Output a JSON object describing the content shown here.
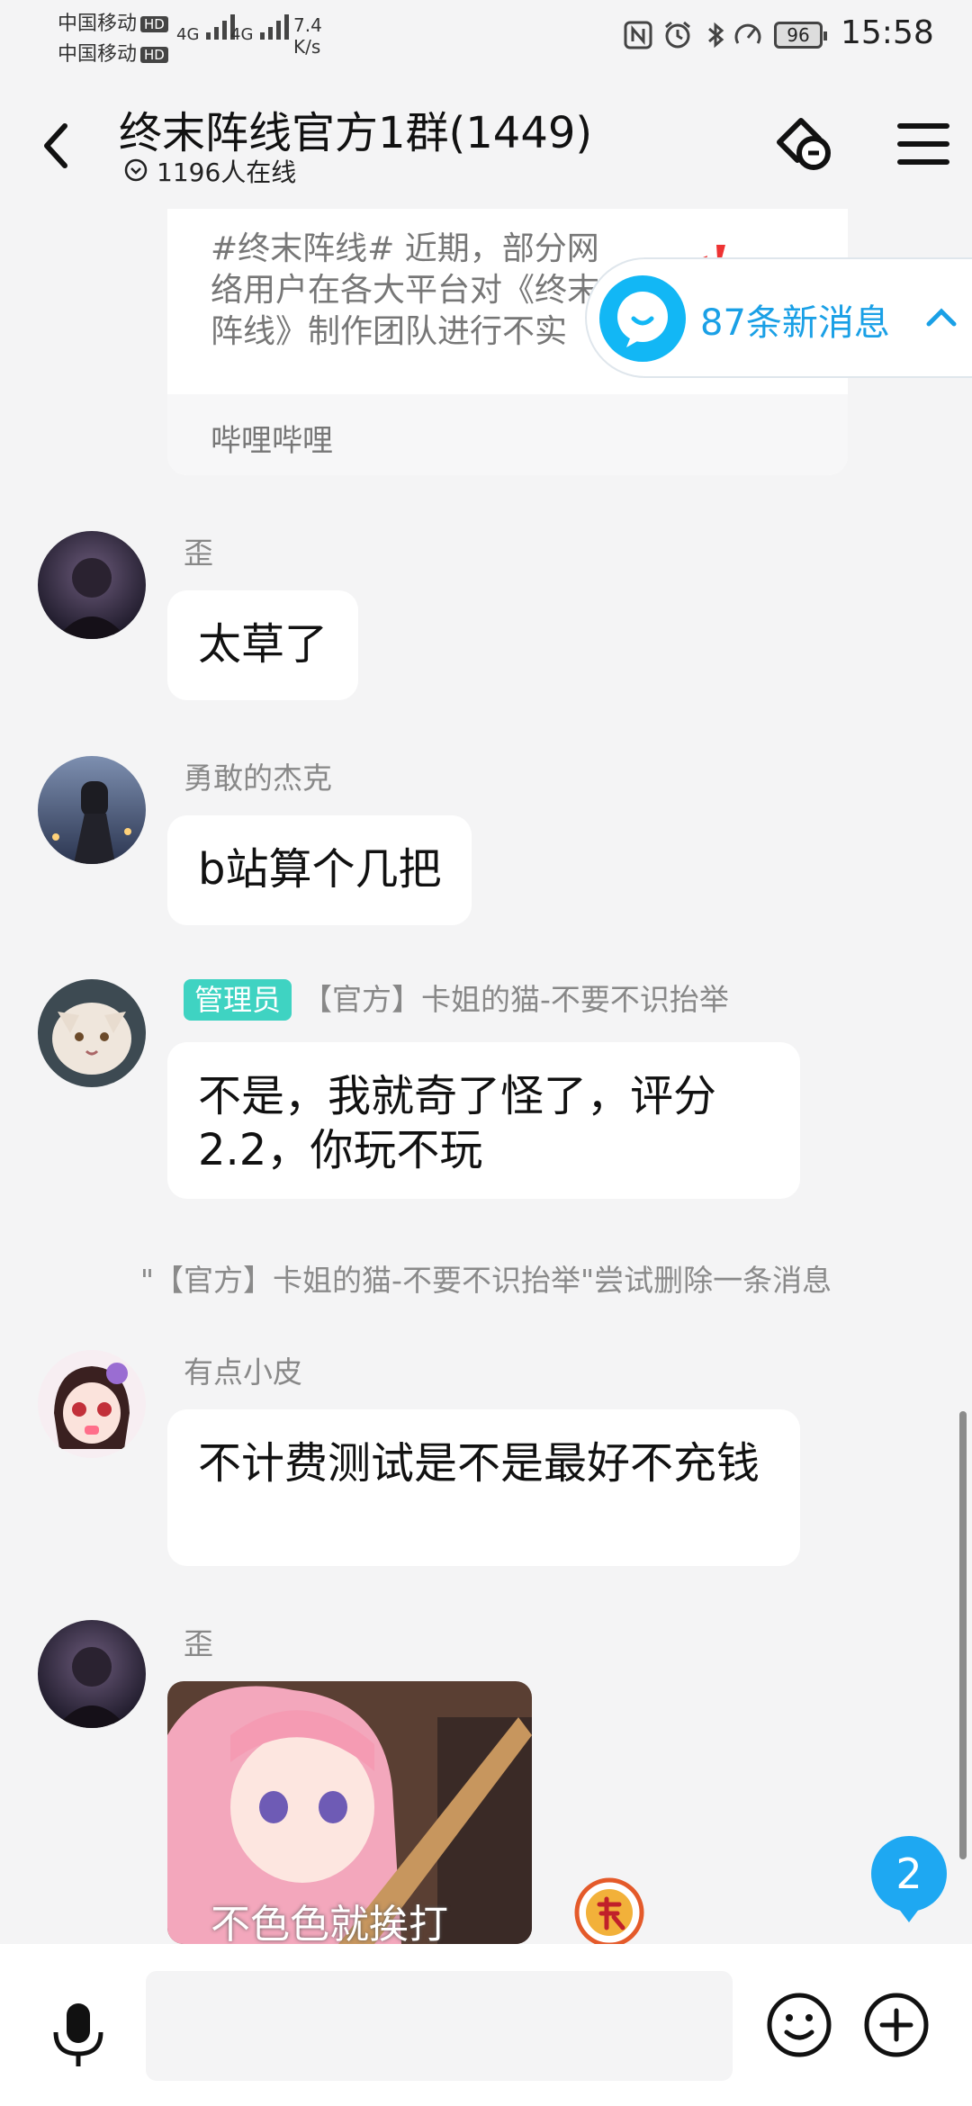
{
  "status_bar": {
    "carrier1": "中国移动",
    "carrier2": "中国移动",
    "hd": "HD",
    "net1": "4G",
    "net2": "4G",
    "speed_value": "7.4",
    "speed_unit": "K/s",
    "battery": "96",
    "time": "15:58",
    "icons": [
      "nfc-icon",
      "alarm-icon",
      "bluetooth-icon",
      "data-saver-icon"
    ]
  },
  "header": {
    "title": "终末阵线官方1群(1449)",
    "online": "1196人在线",
    "icons": [
      "back-icon",
      "link-icon",
      "menu-icon"
    ]
  },
  "shared_card": {
    "text": "#终末阵线# 近期，部分网络用户在各大平台对《终末阵线》制作团队进行不实",
    "source": "哔哩哔哩"
  },
  "new_messages": {
    "label": "87条新消息"
  },
  "messages": [
    {
      "sender": "歪",
      "text": "太草了"
    },
    {
      "sender": "勇敢的杰克",
      "text": "b站算个几把"
    },
    {
      "role": "管理员",
      "sender": "【官方】卡姐的猫-不要不识抬举",
      "text": "不是，我就奇了怪了，评分2.2，你玩不玩"
    },
    {
      "sender": "有点小皮",
      "text": "不计费测试是不是最好不充钱"
    },
    {
      "sender": "歪",
      "image_caption": "不色色就挨打"
    }
  ],
  "system_message": "\"【官方】卡姐的猫-不要不识抬举\"尝试删除一条消息",
  "unread_badge": "2",
  "input_bar": {
    "placeholder": "",
    "icons": [
      "microphone-icon",
      "emoji-icon",
      "plus-icon"
    ]
  },
  "colors": {
    "accent": "#1ea8f2",
    "admin_badge": "#3fd3c2",
    "background": "#f4f4f5"
  }
}
